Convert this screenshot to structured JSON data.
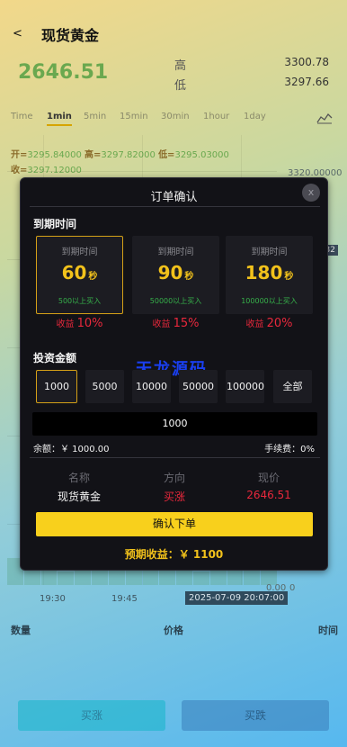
{
  "header": {
    "back": "<",
    "title": "现货黄金"
  },
  "quote": {
    "price": "2646.51",
    "high_label": "高",
    "high_value": "3300.78",
    "low_label": "低",
    "low_value": "3297.66"
  },
  "periods": [
    "Time",
    "1min",
    "5min",
    "15min",
    "30min",
    "1hour",
    "1day"
  ],
  "ohlc": {
    "open_label": "开=",
    "open": "3295.84000",
    "high_label": "高=",
    "high": "3297.82000",
    "low_label": "低=",
    "low": "3295.03000",
    "close_label": "收=",
    "close": "3297.12000"
  },
  "chart_axis": {
    "top_price": "3320.00000",
    "price_tag": "32",
    "bottom": "0.00",
    "bottom_right": "0",
    "times": [
      "19:30",
      "19:45"
    ],
    "current_time": "2025-07-09 20:07:00"
  },
  "list_header": {
    "qty": "数量",
    "price": "价格",
    "time": "时间"
  },
  "bottom_buttons": {
    "buy_up": "买涨",
    "buy_down": "买跌"
  },
  "modal": {
    "title": "订单确认",
    "close": "x",
    "expiry_label": "到期时间",
    "expiry_options": [
      {
        "label": "到期时间",
        "seconds": "60",
        "unit": "秒",
        "min": "500以上买入",
        "yield_label": "收益",
        "yield": "10%"
      },
      {
        "label": "到期时间",
        "seconds": "90",
        "unit": "秒",
        "min": "50000以上买入",
        "yield_label": "收益",
        "yield": "15%"
      },
      {
        "label": "到期时间",
        "seconds": "180",
        "unit": "秒",
        "min": "100000以上买入",
        "yield_label": "收益",
        "yield": "20%"
      }
    ],
    "amount_label": "投资金额",
    "amounts": [
      "1000",
      "5000",
      "10000",
      "50000",
      "100000",
      "全部"
    ],
    "watermark": "天龙源码",
    "amount_value": "1000",
    "balance": "余额：￥ 1000.00",
    "fee": "手续费：0%",
    "info": {
      "name_h": "名称",
      "name_v": "现货黄金",
      "dir_h": "方向",
      "dir_v": "买涨",
      "price_h": "现价",
      "price_v": "2646.51"
    },
    "confirm": "确认下单",
    "expected": "预期收益：￥ 1100"
  },
  "colors": {
    "gold": "#f2c21b",
    "up_red": "#e8283c",
    "green": "#36b04a",
    "price_green": "#6aa84f"
  }
}
